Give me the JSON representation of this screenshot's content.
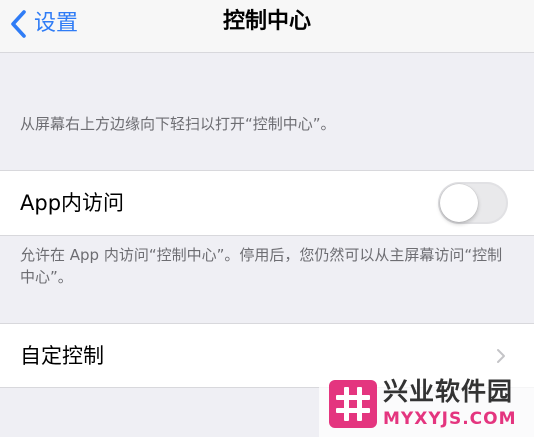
{
  "nav": {
    "back_label": "设置",
    "title": "控制中心"
  },
  "section_header": "从屏幕右上方边缘向下轻扫以打开“控制中心”。",
  "app_access": {
    "label": "App内访问",
    "toggle_on": false,
    "footer": "允许在 App 内访问“控制中心”。停用后，您仍然可以从主屏幕访问“控制中心”。"
  },
  "customize": {
    "label": "自定控制"
  },
  "watermark": {
    "name": "兴业软件园",
    "domain": "MYXYJS.COM"
  },
  "colors": {
    "accent": "#2f7cf6",
    "background": "#efeff4",
    "secondary_text": "#6d6d72",
    "watermark_pink": "#e4357f"
  },
  "icons": {
    "back": "chevron-left-icon",
    "disclosure": "chevron-right-icon",
    "logo": "hash-logo-icon"
  }
}
